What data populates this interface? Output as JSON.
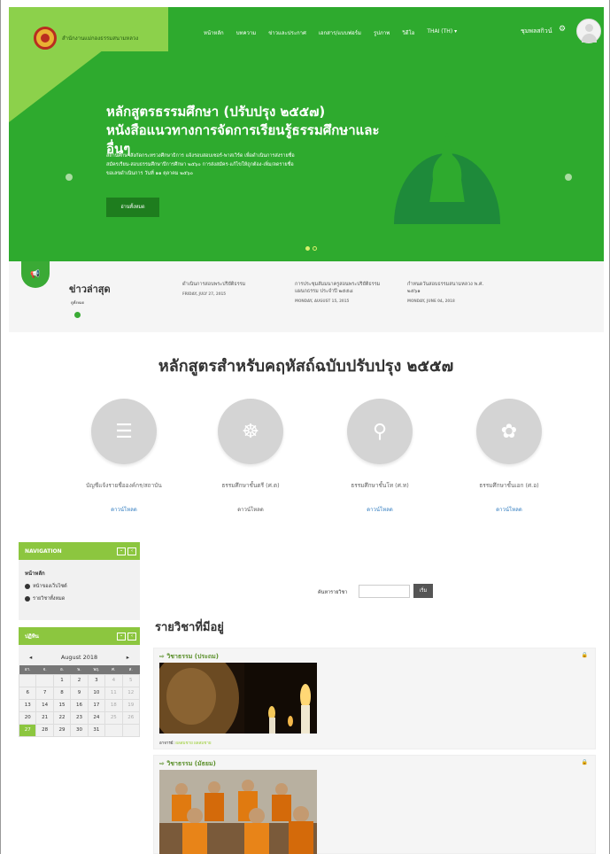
{
  "header": {
    "brand": "สำนักงานแม่กองธรรมสนามหลวง",
    "nav": [
      "หน้าหลัก",
      "บทความ",
      "ข่าวและประกาศ",
      "เอกสาร/แบบฟอร์ม",
      "รูปภาพ",
      "วิดีโอ",
      "THAI (TH) ▾"
    ],
    "user": "ชุมพลสกิวน์"
  },
  "hero": {
    "title_line1": "หลักสูตรธรรมศึกษา (ปรับปรุง ๒๕๕๗)",
    "title_line2": "หนังสือแนวทางการจัดการเรียนรู้ธรรมศึกษาและ",
    "title_line3": "อื่นๆ",
    "desc_line1": "สถานศึกษาสังกัดกระทรวงศึกษาธิการ แจ้งรอบสอบเซอร์-พาสเวิร์ด เพื่อดำเนินการส่งรายชื่อ",
    "desc_line2": "สมัครเรียน-สอบธรรมศึกษาปีการศึกษา ๒๕๖๐ การส่งสมัคร-แก้ไขให้ถูกต้อง-เพิ่ม/ลดรายชื่อ",
    "desc_line3": "ขอเลขดำเนินการ วันที่ ๑๑ ตุลาคม ๒๕๖๐",
    "button": "อ่านทั้งหมด"
  },
  "news": {
    "title": "ข่าวล่าสุด",
    "all": "ดูทั้งหมด",
    "items": [
      {
        "title": "ดำเนินการสอบพระปริยัติธรรม",
        "title2": "",
        "date": "FRIDAY, JULY 27, 2015"
      },
      {
        "title": "การประชุมสัมมนาครูสอนพระปริยัติธรรม",
        "title2": "แผนกธรรม ประจำปี ๒๕๕๘",
        "date": "MONDAY, AUGUST 15, 2015"
      },
      {
        "title": "กำหนดวันสอบธรรมสนามหลวง พ.ศ.",
        "title2": "๒๕๖๑",
        "date": "MONDAY, JUNE 04, 2018"
      }
    ]
  },
  "section": {
    "title": "หลักสูตรสำหรับคฤหัสถ์ฉบับปรับปรุง ๒๕๕๗",
    "items": [
      {
        "label": "บัญชีแจ้งรายชื่อองค์กร/สถาบัน",
        "link": "ดาวน์โหลด",
        "icon": "list-icon"
      },
      {
        "label": "ธรรมศึกษาชั้นตรี (ศ.ต)",
        "link": "ดาวน์โหลด",
        "icon": "dharma-wheel-icon"
      },
      {
        "label": "ธรรมศึกษาชั้นโท (ศ.ท)",
        "link": "ดาวน์โหลด",
        "icon": "meditation-icon"
      },
      {
        "label": "ธรรมศึกษาชั้นเอก (ศ.อ)",
        "link": "ดาวน์โหลด",
        "icon": "lotus-icon"
      }
    ]
  },
  "sidebar": {
    "navigation": "NAVIGATION",
    "home": "หน้าหลัก",
    "items": [
      "หน้าของเว็บไซต์",
      "รายวิชาทั้งหมด"
    ],
    "calendar_title": "ปฏิทิน",
    "month": "August 2018",
    "weekdays": [
      "อา.",
      "จ.",
      "อ.",
      "พ.",
      "พฤ.",
      "ศ.",
      "ส."
    ],
    "weeks": [
      [
        "",
        "",
        "1",
        "2",
        "3",
        "4",
        "5"
      ],
      [
        "6",
        "7",
        "8",
        "9",
        "10",
        "11",
        "12"
      ],
      [
        "13",
        "14",
        "15",
        "16",
        "17",
        "18",
        "19"
      ],
      [
        "20",
        "21",
        "22",
        "23",
        "24",
        "25",
        "26"
      ],
      [
        "27",
        "28",
        "29",
        "30",
        "31",
        "",
        ""
      ]
    ]
  },
  "main": {
    "search_label": "ค้นหารายวิชา",
    "search_button": "เริ่ม",
    "courses_title": "รายวิชาที่มีอยู่",
    "courses": [
      {
        "name": "วิชาธรรม (ประถม)",
        "teacher_label": "อาจารย์",
        "teacher": "ผลสมชาย ผลสมชาย"
      },
      {
        "name": "วิชาธรรม (มัธยม)"
      }
    ]
  }
}
